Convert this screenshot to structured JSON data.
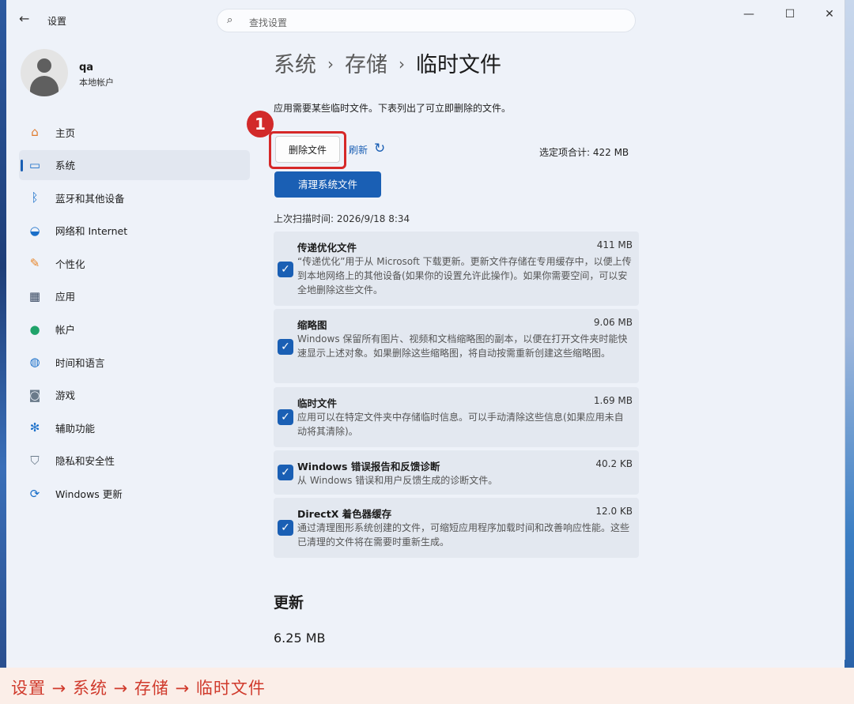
{
  "window": {
    "back_icon": "back-arrow-icon",
    "title": "设置",
    "search_placeholder": "查找设置",
    "controls": [
      "minimize-icon",
      "maximize-icon",
      "close-icon"
    ]
  },
  "user": {
    "name": "qa",
    "account_type": "本地帐户"
  },
  "sidebar": {
    "items": [
      {
        "label": "主页",
        "icon": "home-icon",
        "color": "#e07a2c"
      },
      {
        "label": "系统",
        "icon": "system-icon",
        "color": "#1a6fc9",
        "selected": true
      },
      {
        "label": "蓝牙和其他设备",
        "icon": "bluetooth-icon",
        "color": "#1a6fc9"
      },
      {
        "label": "网络和 Internet",
        "icon": "wifi-icon",
        "color": "#1a6fc9"
      },
      {
        "label": "个性化",
        "icon": "brush-icon",
        "color": "#e8862a"
      },
      {
        "label": "应用",
        "icon": "apps-icon",
        "color": "#3a4a63"
      },
      {
        "label": "帐户",
        "icon": "person-icon",
        "color": "#1fa36a"
      },
      {
        "label": "时间和语言",
        "icon": "globe-clock-icon",
        "color": "#1a6fc9"
      },
      {
        "label": "游戏",
        "icon": "gamepad-icon",
        "color": "#6a7a8a"
      },
      {
        "label": "辅助功能",
        "icon": "accessibility-icon",
        "color": "#1a6fc9"
      },
      {
        "label": "隐私和安全性",
        "icon": "shield-icon",
        "color": "#6a7a8a"
      },
      {
        "label": "Windows 更新",
        "icon": "update-icon",
        "color": "#1a6fc9"
      }
    ]
  },
  "breadcrumb": {
    "level1": "系统",
    "level2": "存储",
    "current": "临时文件",
    "separator": "›"
  },
  "main": {
    "description": "应用需要某些临时文件。下表列出了可立即删除的文件。",
    "step_badge": "1",
    "delete_button": "删除文件",
    "refresh_button": "刷新",
    "selected_total": "选定项合计: 422 MB",
    "clean_button": "清理系统文件",
    "last_scan": "上次扫描时间: 2026/9/18 8:34"
  },
  "files": [
    {
      "title": "传递优化文件",
      "size": "411 MB",
      "checked": true,
      "desc": "“传递优化”用于从 Microsoft 下载更新。更新文件存储在专用缓存中，以便上传到本地网络上的其他设备(如果你的设置允许此操作)。如果你需要空间，可以安全地删除这些文件。"
    },
    {
      "title": "缩略图",
      "size": "9.06 MB",
      "checked": true,
      "desc": "Windows 保留所有图片、视频和文档缩略图的副本，以便在打开文件夹时能快速显示上述对象。如果删除这些缩略图，将自动按需重新创建这些缩略图。"
    },
    {
      "title": "临时文件",
      "size": "1.69 MB",
      "checked": true,
      "desc": "应用可以在特定文件夹中存储临时信息。可以手动清除这些信息(如果应用未自动将其清除)。"
    },
    {
      "title": "Windows 错误报告和反馈诊断",
      "size": "40.2 KB",
      "checked": true,
      "desc": "从 Windows 错误和用户反馈生成的诊断文件。"
    },
    {
      "title": "DirectX 着色器缓存",
      "size": "12.0 KB",
      "checked": true,
      "desc": "通过清理图形系统创建的文件，可缩短应用程序加载时间和改善响应性能。这些已清理的文件将在需要时重新生成。"
    }
  ],
  "update_section": {
    "title": "更新",
    "size": "6.25 MB"
  },
  "caption": "设置 → 系统 → 存储 → 临时文件",
  "colors": {
    "accent": "#1a5fb4",
    "highlight": "#d62828",
    "caption_text": "#d03a2c"
  }
}
